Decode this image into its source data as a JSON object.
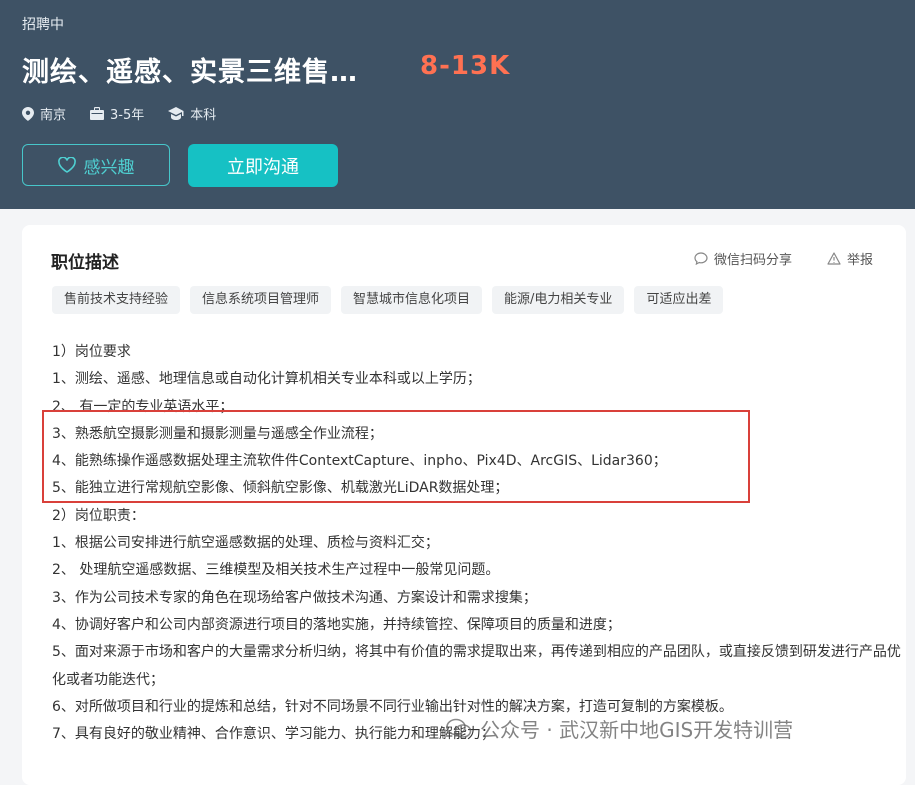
{
  "header": {
    "status": "招聘中",
    "title": "测绘、遥感、实景三维售…",
    "salary": "8-13K",
    "location": "南京",
    "experience": "3-5年",
    "education": "本科",
    "fav_label": "感兴趣",
    "chat_label": "立即沟通"
  },
  "card": {
    "title": "职位描述",
    "share_label": "微信扫码分享",
    "report_label": "举报",
    "tags": [
      "售前技术支持经验",
      "信息系统项目管理师",
      "智慧城市信息化项目",
      "能源/电力相关专业",
      "可适应出差"
    ]
  },
  "description": [
    "1）岗位要求",
    "1、测绘、遥感、地理信息或自动化计算机相关专业本科或以上学历；",
    "2、 有一定的专业英语水平；",
    "3、熟悉航空摄影测量和摄影测量与遥感全作业流程；",
    "4、能熟练操作遥感数据处理主流软件件ContextCapture、inpho、Pix4D、ArcGIS、Lidar360；",
    "5、能独立进行常规航空影像、倾斜航空影像、机载激光LiDAR数据处理；",
    "2）岗位职责：",
    "1、根据公司安排进行航空遥感数据的处理、质检与资料汇交；",
    "2、 处理航空遥感数据、三维模型及相关技术生产过程中一般常见问题。",
    "3、作为公司技术专家的角色在现场给客户做技术沟通、方案设计和需求搜集；",
    "4、协调好客户和公司内部资源进行项目的落地实施，并持续管控、保障项目的质量和进度；",
    "5、面对来源于市场和客户的大量需求分析归纳，将其中有价值的需求提取出来，再传递到相应的产品团队，或直接反馈到研发进行产品优化或者功能迭代；",
    "6、对所做项目和行业的提炼和总结，针对不同场景不同行业输出针对性的解决方案，打造可复制的方案模板。",
    "7、具有良好的敬业精神、合作意识、学习能力、执行能力和理解能力；"
  ],
  "watermark": "公众号 · 武汉新中地GIS开发特训营",
  "colors": {
    "header_bg": "#3e5265",
    "accent": "#16c1c4",
    "salary": "#ff7152",
    "highlight": "#d9403a"
  }
}
